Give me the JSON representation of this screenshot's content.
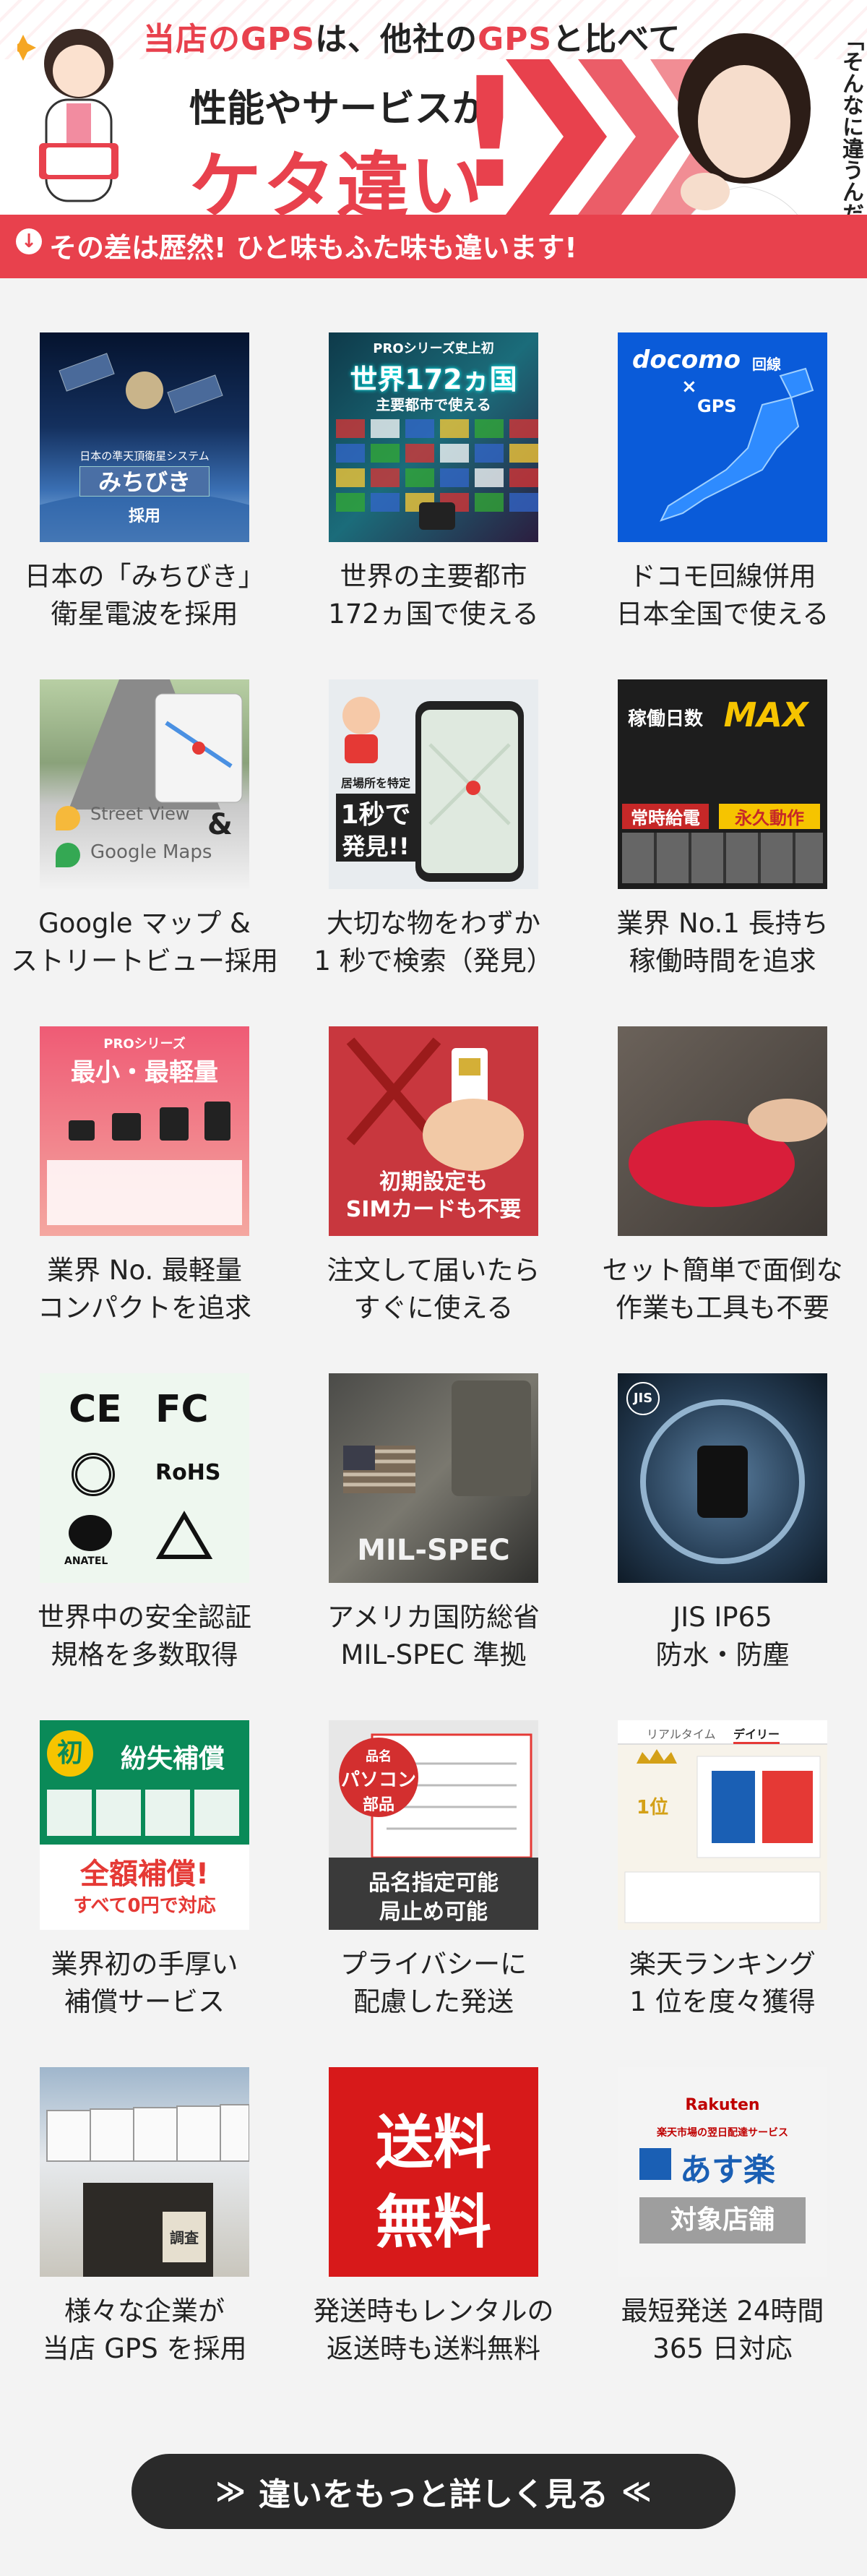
{
  "banner": {
    "tagline_part1": "当店の",
    "tagline_gps1": "GPS",
    "tagline_part2": "は、他社の",
    "tagline_gps2": "GPS",
    "tagline_part3": "と比べて",
    "line2": "性能やサービスが",
    "line3": "ケタ違い",
    "bang": "!",
    "footer": "その差は歴然! ひと味もふた味も違います!",
    "quote": "「そんなに違うんだ…」",
    "accent_color": "#e8414d"
  },
  "features": [
    {
      "caption_1": "日本の「みちびき」",
      "caption_2": "衛星電波を採用",
      "thumb": "space",
      "label_1": "日本の準天頂衛星システム",
      "label_2": "みちびき",
      "label_3": "採用"
    },
    {
      "caption_1": "世界の主要都市",
      "caption_2": "172ヵ国で使える",
      "thumb": "world",
      "label_1": "PROシリーズ史上初",
      "label_2": "世界172ヵ国",
      "label_3": "主要都市で使える"
    },
    {
      "caption_1": "ドコモ回線併用",
      "caption_2": "日本全国で使える",
      "thumb": "docomo",
      "label_1": "docomo",
      "label_2": "回線",
      "label_3": "GPS"
    },
    {
      "caption_1": "Google マップ &",
      "caption_2": "ストリートビュー採用",
      "thumb": "street",
      "label_1": "Street View",
      "label_2": "Google Maps",
      "label_3": "&"
    },
    {
      "caption_1": "大切な物をわずか",
      "caption_2": "1 秒で検索（発見）",
      "thumb": "phone",
      "label_1": "居場所を特定",
      "label_2": "1秒で",
      "label_3": "発見!!"
    },
    {
      "caption_1": "業界 No.1 長持ち",
      "caption_2": "稼働時間を追求",
      "thumb": "pro",
      "label_1": "稼働日数",
      "label_2": "MAX",
      "label_3": "常時給電",
      "label_4": "永久動作"
    },
    {
      "caption_1": "業界 No. 最軽量",
      "caption_2": "コンパクトを追求",
      "thumb": "small",
      "label_1": "PROシリーズ",
      "label_2": "最小・最軽量"
    },
    {
      "caption_1": "注文して届いたら",
      "caption_2": "すぐに使える",
      "thumb": "sim",
      "label_1": "初期設定も",
      "label_2": "SIMカードも不要"
    },
    {
      "caption_1": "セット簡単で面倒な",
      "caption_2": "作業も工具も不要",
      "thumb": "hand"
    },
    {
      "caption_1": "世界中の安全認証",
      "caption_2": "規格を多数取得",
      "thumb": "cert",
      "label_1": "CE",
      "label_2": "FC",
      "label_3": "RoHS",
      "label_4": "ANATEL"
    },
    {
      "caption_1": "アメリカ国防総省",
      "caption_2": "MIL-SPEC 準拠",
      "thumb": "mil",
      "label_1": "MIL-SPEC"
    },
    {
      "caption_1": "JIS IP65",
      "caption_2": "防水・防塵",
      "thumb": "jis",
      "label_1": "JIS"
    },
    {
      "caption_1": "業界初の手厚い",
      "caption_2": "補償サービス",
      "thumb": "comp",
      "label_1": "初",
      "label_2": "紛失補償",
      "label_3": "全額補償!",
      "label_4": "すべて0円で対応"
    },
    {
      "caption_1": "プライバシーに",
      "caption_2": "配慮した発送",
      "thumb": "priv",
      "label_1": "品名",
      "label_2": "パソコン",
      "label_3": "部品",
      "label_4": "品名指定可能",
      "label_5": "局止め可能"
    },
    {
      "caption_1": "楽天ランキング",
      "caption_2": "1 位を度々獲得",
      "thumb": "rank",
      "label_1": "リアルタイム",
      "label_2": "デイリー",
      "label_3": "1位"
    },
    {
      "caption_1": "様々な企業が",
      "caption_2": "当店 GPS を採用",
      "thumb": "truck",
      "label_1": "調査"
    },
    {
      "caption_1": "発送時もレンタルの",
      "caption_2": "返送時も送料無料",
      "thumb": "free",
      "label_1": "送料",
      "label_2": "無料"
    },
    {
      "caption_1": "最短発送 24時間",
      "caption_2": "365 日対応",
      "thumb": "asu",
      "label_1": "Rakuten",
      "label_2": "楽天市場の翌日配達サービス",
      "label_3": "あす楽",
      "label_4": "対象店舗"
    }
  ],
  "more_button": {
    "label": "違いをもっと詳しく見る",
    "left_chevron": "≫",
    "right_chevron": "≪"
  }
}
